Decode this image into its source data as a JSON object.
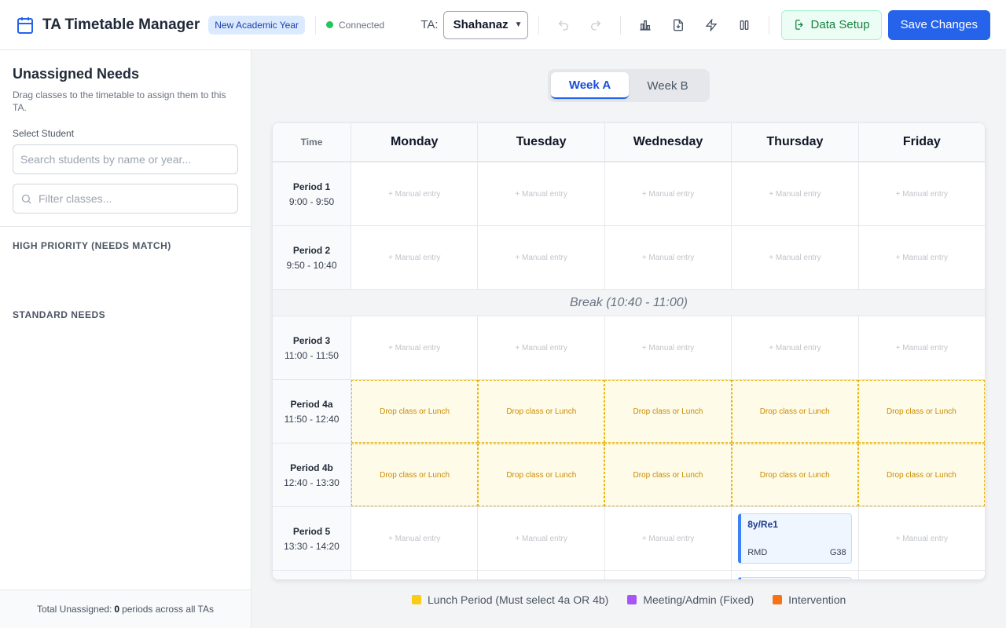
{
  "header": {
    "title": "TA Timetable Manager",
    "year_badge": "New Academic Year",
    "status": "Connected",
    "ta_label": "TA:",
    "ta_selected": "Shahanaz",
    "data_setup_label": "Data Setup",
    "save_label": "Save Changes",
    "icons": [
      "undo-icon",
      "redo-icon",
      "bar-chart-icon",
      "file-download-icon",
      "lightning-icon",
      "columns-icon"
    ]
  },
  "sidebar": {
    "title": "Unassigned Needs",
    "description": "Drag classes to the timetable to assign them to this TA.",
    "select_label": "Select Student",
    "search_placeholder": "Search students by name or year...",
    "filter_placeholder": "Filter classes...",
    "high_priority_heading": "HIGH PRIORITY (NEEDS MATCH)",
    "standard_heading": "STANDARD NEEDS",
    "footer_prefix": "Total Unassigned:",
    "footer_count": "0",
    "footer_suffix": "periods across all TAs"
  },
  "weeks": {
    "a": "Week A",
    "b": "Week B",
    "active": "Week A"
  },
  "grid": {
    "time_header": "Time",
    "days": [
      "Monday",
      "Tuesday",
      "Wednesday",
      "Thursday",
      "Friday"
    ],
    "manual_entry": "+ Manual entry",
    "lunch_text": "Drop class or Lunch",
    "break_label": "Break (10:40 - 11:00)",
    "periods": [
      {
        "name": "Period 1",
        "time": "9:00 - 9:50"
      },
      {
        "name": "Period 2",
        "time": "9:50 - 10:40"
      },
      {
        "name": "Period 3",
        "time": "11:00 - 11:50"
      },
      {
        "name": "Period 4a",
        "time": "11:50 - 12:40"
      },
      {
        "name": "Period 4b",
        "time": "12:40 - 13:30"
      },
      {
        "name": "Period 5",
        "time": "13:30 - 14:20"
      }
    ],
    "class_card": {
      "name": "8y/Re1",
      "teacher": "RMD",
      "room": "G38"
    }
  },
  "legend": [
    {
      "label": "Lunch Period (Must select 4a OR 4b)",
      "color": "#facc15"
    },
    {
      "label": "Meeting/Admin (Fixed)",
      "color": "#a855f7"
    },
    {
      "label": "Intervention",
      "color": "#f97316"
    }
  ]
}
